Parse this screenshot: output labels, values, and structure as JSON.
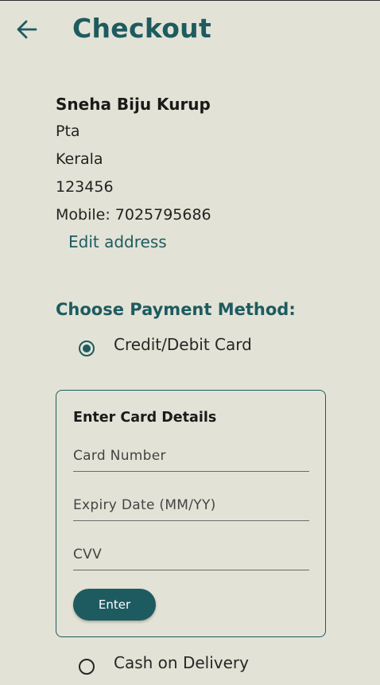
{
  "header": {
    "back_icon": "arrow-left-icon",
    "title": "Checkout"
  },
  "address": {
    "name": "Sneha Biju Kurup",
    "lines": [
      "Pta",
      "Kerala",
      "123456",
      "Mobile: 7025795686"
    ],
    "edit_label": "Edit address"
  },
  "payment": {
    "title": "Choose Payment Method:",
    "options": [
      {
        "label": "Credit/Debit Card",
        "selected": true
      },
      {
        "label": "Cash on Delivery",
        "selected": false
      }
    ],
    "card_form": {
      "heading": "Enter Card Details",
      "card_number_placeholder": "Card Number",
      "expiry_placeholder": "Expiry Date (MM/YY)",
      "cvv_placeholder": "CVV",
      "submit_label": "Enter"
    }
  },
  "colors": {
    "background": "#e2e3d6",
    "accent": "#1e5b60",
    "text": "#1a1a1a"
  }
}
